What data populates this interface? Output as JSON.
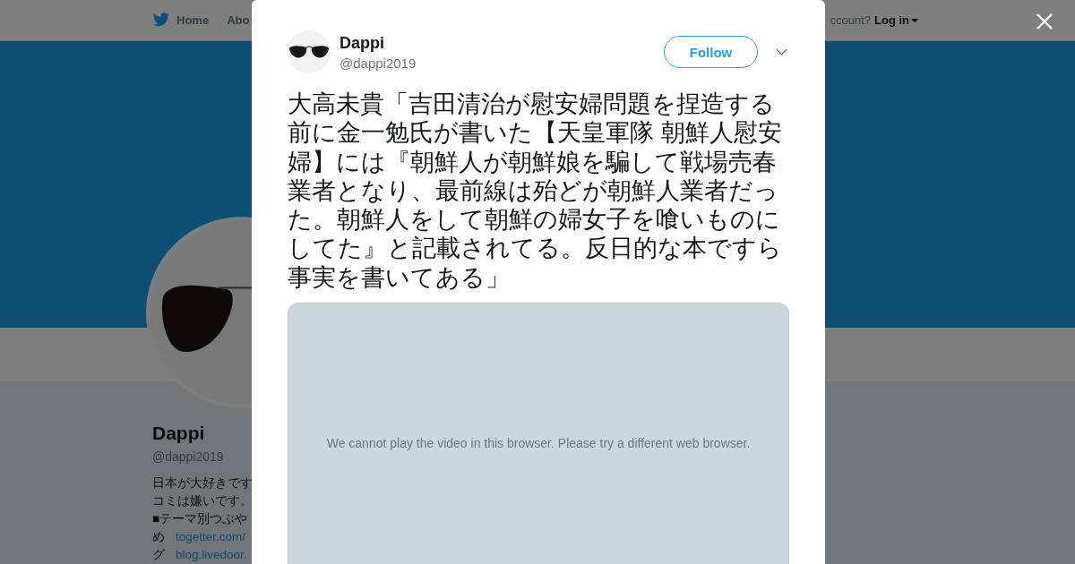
{
  "nav": {
    "home": "Home",
    "about": "Abo",
    "account_prompt": "ccount?",
    "login": "Log in"
  },
  "profile": {
    "name": "Dappi",
    "handle": "@dappi2019",
    "bio": [
      {
        "text": "日本が大好きです"
      },
      {
        "text": "コミは嫌いです。"
      },
      {
        "text": "■テーマ別つぶや"
      },
      {
        "text": "め",
        "link": "togetter.com/"
      },
      {
        "text": "グ",
        "link": "blog.livedoor."
      }
    ]
  },
  "tweet": {
    "author": "Dappi",
    "handle": "@dappi2019",
    "follow_button": "Follow",
    "text": "大高未貴「吉田清治が慰安婦問題を捏造する前に金一勉氏が書いた【天皇軍隊 朝鮮人慰安婦】には『朝鮮人が朝鮮娘を騙して戦場売春業者となり、最前線は殆どが朝鮮人業者だった。朝鮮人をして朝鮮の婦女子を喰いものにしてた』と記載されてる。反日的な本ですら事実を書いてある」",
    "video_message": "We cannot play the video in this browser. Please try a different web browser."
  }
}
